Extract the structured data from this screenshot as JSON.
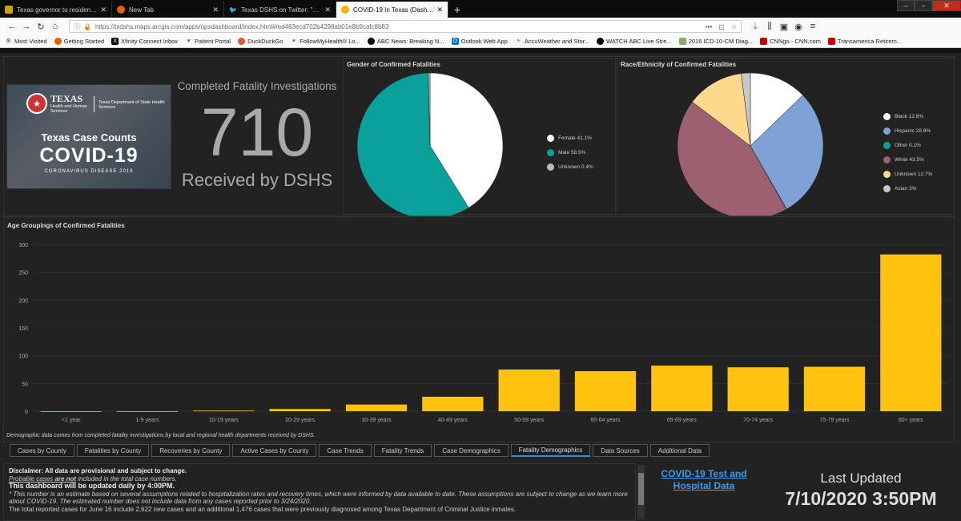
{
  "browser": {
    "tabs": [
      {
        "title": "Texas governor to residents: \"T",
        "color": "#d6a100"
      },
      {
        "title": "New Tab",
        "color": "#e66000"
      },
      {
        "title": "Texas DSHS on Twitter: \"#COVI",
        "color": "#1da1f2"
      },
      {
        "title": "COVID-19 In Texas (Dashboard)",
        "color": "#ffb000"
      }
    ],
    "url": "https://txdshs.maps.arcgis.com/apps/opsdashboard/index.html#/ed483ecd702b4298ab01e8b9cafc8b83",
    "bookmarks": [
      "Most Visited",
      "Getting Started",
      "Xfinity Connect Inbox",
      "Patient Portal",
      "DuckDuckGo",
      "FollowMyHealth® Lo...",
      "ABC News: Breaking N...",
      "Outlook Web App",
      "AccuWeather and Stor...",
      "WATCH ABC Live Stre...",
      "2016 ICD-10-CM Diag...",
      "CNNgo - CNN.com",
      "Transamerica Retirem..."
    ]
  },
  "header_image": {
    "texas": "TEXAS",
    "hhs": "Health and Human Services",
    "dshs": "Texas Department of State Health Services",
    "case_counts": "Texas Case Counts",
    "covid": "COVID-19",
    "disease": "CORONAVIRUS DISEASE 2019"
  },
  "fatality_indicator": {
    "top_text": "Completed Fatality Investigations",
    "value": "710",
    "bottom_text": "Received by DSHS"
  },
  "gender_chart": {
    "title": "Gender of Confirmed Fatalities",
    "chart_data": {
      "type": "pie",
      "slices": [
        {
          "label": "Female",
          "value": 41.1,
          "display": "Female  41.1%",
          "color": "#ffffff"
        },
        {
          "label": "Male",
          "value": 58.5,
          "display": "Male  58.5%",
          "color": "#0aa19a"
        },
        {
          "label": "Unknown",
          "value": 0.4,
          "display": "Unknown  0.4%",
          "color": "#bbbbbb"
        }
      ]
    }
  },
  "race_chart": {
    "title": "Race/Ethnicity of Confirmed Fatalities",
    "chart_data": {
      "type": "pie",
      "slices": [
        {
          "label": "Asian",
          "value": 2,
          "display": "Asian  2%",
          "color": "#c8c8c8"
        },
        {
          "label": "Black",
          "value": 12.8,
          "display": "Black  12.8%",
          "color": "#ffffff"
        },
        {
          "label": "Hispanic",
          "value": 28.9,
          "display": "Hispanic  28.9%",
          "color": "#7fa2d4"
        },
        {
          "label": "Other",
          "value": 0.1,
          "display": "Other  0.1%",
          "color": "#0aa19a"
        },
        {
          "label": "White",
          "value": 43.5,
          "display": "White  43.5%",
          "color": "#9c6070"
        },
        {
          "label": "Unknown",
          "value": 12.7,
          "display": "Unknown  12.7%",
          "color": "#fdd98d"
        }
      ]
    }
  },
  "age_chart": {
    "title": "Age Groupings of Confirmed Fatalities",
    "chart_data": {
      "type": "bar",
      "categories": [
        "<1 year",
        "1-9 years",
        "10-19 years",
        "20-29 years",
        "30-39 years",
        "40-49 years",
        "50-59 years",
        "60-64 years",
        "65-69 years",
        "70-74 years",
        "75-79 years",
        "80+ years"
      ],
      "values": [
        0,
        0,
        1,
        4,
        12,
        26,
        75,
        72,
        82,
        79,
        80,
        282
      ],
      "ylim": [
        0,
        300
      ],
      "yticks": [
        "0",
        "50",
        "100",
        "150",
        "200",
        "250",
        "300"
      ],
      "bar_color": "#ffc20e",
      "grid": true
    },
    "footnote": "Demographic data comes from completed fatality investigations by local and regional health departments received by DSHS."
  },
  "dashboard_tabs": [
    "Cases by County",
    "Fatalities by County",
    "Recoveries by County",
    "Active Cases by County",
    "Case Trends",
    "Fatality Trends",
    "Case Demographics",
    "Fatality Demographics",
    "Data Sources",
    "Additional Data"
  ],
  "disclaimer": {
    "line1": "Disclaimer: All data are provisional and subject to change.",
    "line2a": "Probable cases ",
    "line2b": "are not",
    "line2c": " included in the total case numbers.",
    "line3": "This dashboard will be updated daily by 4:00PM.",
    "line4": "* This number is an estimate based on several assumptions related to hospitalization rates and recovery times, which were informed by data available to date. These assumptions are subject to change as we learn more about COVID-19. The estimated number does not include data from any cases reported prior to 3/24/2020.",
    "line5": "The total reported cases for June 16 include 2,622 new cases and an additional 1,476 cases that were previously diagnosed among Texas Department of Criminal Justice inmates."
  },
  "test_link": "COVID-19 Test and Hospital Data",
  "last_updated": {
    "label": "Last Updated",
    "value": "7/10/2020 3:50PM"
  }
}
